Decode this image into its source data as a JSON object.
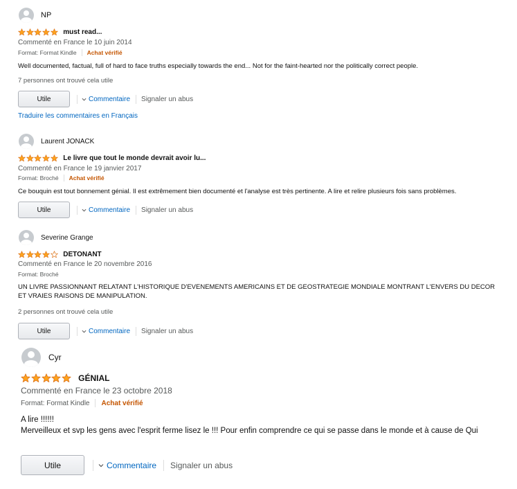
{
  "colors": {
    "link": "#0066c0",
    "verified": "#c45500",
    "star": "#ffa41c",
    "star_border": "#de7921",
    "meta": "#565959"
  },
  "reviews": [
    {
      "author": "NP",
      "rating": 5,
      "title": "must read...",
      "date": "Commenté en France le 10 juin 2014",
      "format": "Format: Format Kindle",
      "verified": "Achat vérifié",
      "body": "Well documented, factual, full of hard to face truths especially towards the end... Not for the faint-hearted nor the politically correct people.",
      "helpful": "7 personnes ont trouvé cela utile",
      "helpful_button": "Utile",
      "comment_link": "Commentaire",
      "report_link": "Signaler un abus"
    },
    {
      "author": "Laurent JONACK",
      "rating": 5,
      "title": "Le livre que tout le monde devrait avoir lu...",
      "date": "Commenté en France le 19 janvier 2017",
      "format": "Format: Broché",
      "verified": "Achat vérifié",
      "body": "Ce bouquin est tout bonnement génial. Il est extrêmement bien documenté et l'analyse est très pertinente. A lire et relire plusieurs fois sans problèmes.",
      "helpful_button": "Utile",
      "comment_link": "Commentaire",
      "report_link": "Signaler un abus"
    },
    {
      "author": "Severine Grange",
      "rating": 4,
      "title": "DETONANT",
      "date": "Commenté en France le 20 novembre 2016",
      "format": "Format: Broché",
      "body": "UN LIVRE PASSIONNANT RELATANT L'HISTORIQUE D'EVENEMENTS AMERICAINS ET DE GEOSTRATEGIE MONDIALE MONTRANT L'ENVERS DU DECOR ET VRAIES RAISONS DE MANIPULATION.",
      "helpful": "2 personnes ont trouvé cela utile",
      "helpful_button": "Utile",
      "comment_link": "Commentaire",
      "report_link": "Signaler un abus"
    },
    {
      "author": "Cyr",
      "rating": 5,
      "title": "GÉNIAL",
      "date": "Commenté en France le 23 octobre 2018",
      "format": "Format: Format Kindle",
      "verified": "Achat vérifié",
      "body_line1": "A lire !!!!!!",
      "body_line2": "Merveilleux et svp les gens avec l'esprit ferme lisez le !!! Pour enfin comprendre ce qui se passe dans le monde et à cause de Qui",
      "helpful_button": "Utile",
      "comment_link": "Commentaire",
      "report_link": "Signaler un abus"
    }
  ],
  "translate_link": "Traduire les commentaires en Français"
}
